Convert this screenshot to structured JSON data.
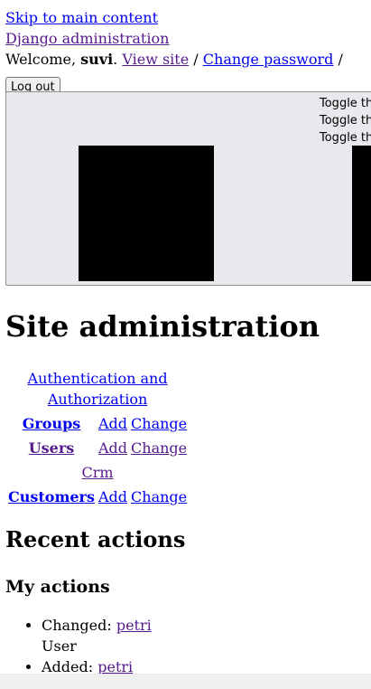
{
  "skip_link": "Skip to main content",
  "site_name": "Django administration",
  "user_tools": {
    "welcome": "Welcome,",
    "username": "suvi",
    "view_site": "View site",
    "change_password": "Change password",
    "sep": "/",
    "logout": "Log out"
  },
  "toolbar": {
    "toggle_labels": [
      "Toggle th",
      "Toggle th",
      "Toggle th"
    ]
  },
  "page_title": "Site administration",
  "apps": {
    "auth_caption": "Authentication and Authorization",
    "crm_caption": "Crm",
    "add_label": "Add",
    "change_label": "Change",
    "models": {
      "groups": "Groups",
      "users": "Users",
      "customers": "Customers"
    }
  },
  "recent": {
    "title": "Recent actions",
    "mine": "My actions",
    "items": [
      {
        "action": "Changed:",
        "object": "petri",
        "type": "User"
      },
      {
        "action": "Added:",
        "object": "petri"
      }
    ]
  }
}
